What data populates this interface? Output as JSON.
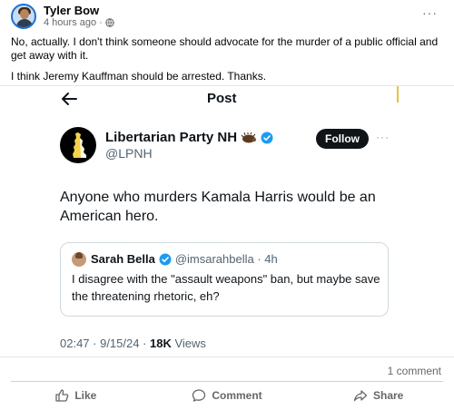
{
  "post": {
    "author": "Tyler Bow",
    "timestamp": "4 hours ago",
    "privacy_icon": "globe-icon",
    "more_label": "···",
    "paragraphs": [
      "No, actually. I don't think someone should advocate for the murder of a public official and get away with it.",
      "I think Jeremy Kauffman should be arrested. Thanks."
    ]
  },
  "screenshot": {
    "header_title": "Post",
    "account_name": "Libertarian Party NH",
    "account_handle": "@LPNH",
    "follow_label": "Follow",
    "more_label": "···",
    "tweet_text": "Anyone who murders Kamala Harris would be an American hero.",
    "quote": {
      "name": "Sarah Bella",
      "handle": "@imsarahbella · 4h",
      "text": "I disagree with the \"assault weapons\" ban, but maybe save the threatening rhetoric, eh?"
    },
    "footer_time": "02:47 · 9/15/24 · ",
    "views_count": "18K",
    "views_label": " Views"
  },
  "engagement": {
    "comments": "1 comment"
  },
  "actions": {
    "like": "Like",
    "comment": "Comment",
    "share": "Share"
  },
  "colors": {
    "accent": "#1d9bf0",
    "facebook_text": "#050505",
    "muted": "#65676b",
    "x_text": "#0f1419"
  }
}
